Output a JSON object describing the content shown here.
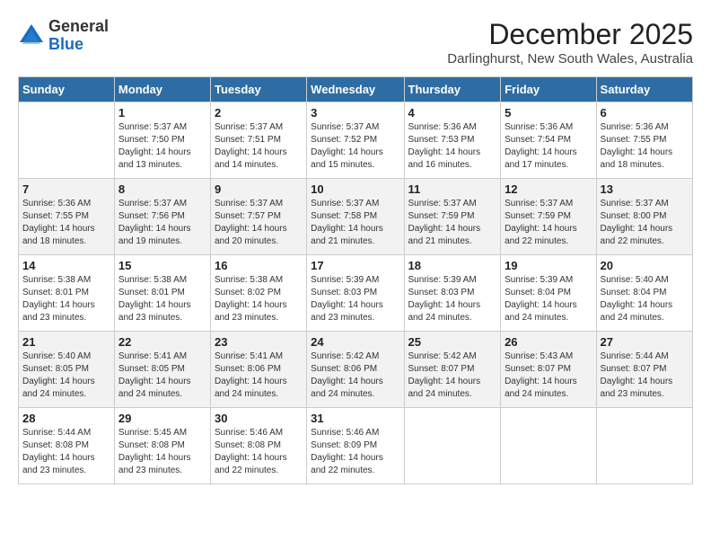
{
  "header": {
    "logo_general": "General",
    "logo_blue": "Blue",
    "month_title": "December 2025",
    "location": "Darlinghurst, New South Wales, Australia"
  },
  "weekdays": [
    "Sunday",
    "Monday",
    "Tuesday",
    "Wednesday",
    "Thursday",
    "Friday",
    "Saturday"
  ],
  "weeks": [
    [
      {
        "day": "",
        "detail": ""
      },
      {
        "day": "1",
        "detail": "Sunrise: 5:37 AM\nSunset: 7:50 PM\nDaylight: 14 hours\nand 13 minutes."
      },
      {
        "day": "2",
        "detail": "Sunrise: 5:37 AM\nSunset: 7:51 PM\nDaylight: 14 hours\nand 14 minutes."
      },
      {
        "day": "3",
        "detail": "Sunrise: 5:37 AM\nSunset: 7:52 PM\nDaylight: 14 hours\nand 15 minutes."
      },
      {
        "day": "4",
        "detail": "Sunrise: 5:36 AM\nSunset: 7:53 PM\nDaylight: 14 hours\nand 16 minutes."
      },
      {
        "day": "5",
        "detail": "Sunrise: 5:36 AM\nSunset: 7:54 PM\nDaylight: 14 hours\nand 17 minutes."
      },
      {
        "day": "6",
        "detail": "Sunrise: 5:36 AM\nSunset: 7:55 PM\nDaylight: 14 hours\nand 18 minutes."
      }
    ],
    [
      {
        "day": "7",
        "detail": "Sunrise: 5:36 AM\nSunset: 7:55 PM\nDaylight: 14 hours\nand 18 minutes."
      },
      {
        "day": "8",
        "detail": "Sunrise: 5:37 AM\nSunset: 7:56 PM\nDaylight: 14 hours\nand 19 minutes."
      },
      {
        "day": "9",
        "detail": "Sunrise: 5:37 AM\nSunset: 7:57 PM\nDaylight: 14 hours\nand 20 minutes."
      },
      {
        "day": "10",
        "detail": "Sunrise: 5:37 AM\nSunset: 7:58 PM\nDaylight: 14 hours\nand 21 minutes."
      },
      {
        "day": "11",
        "detail": "Sunrise: 5:37 AM\nSunset: 7:59 PM\nDaylight: 14 hours\nand 21 minutes."
      },
      {
        "day": "12",
        "detail": "Sunrise: 5:37 AM\nSunset: 7:59 PM\nDaylight: 14 hours\nand 22 minutes."
      },
      {
        "day": "13",
        "detail": "Sunrise: 5:37 AM\nSunset: 8:00 PM\nDaylight: 14 hours\nand 22 minutes."
      }
    ],
    [
      {
        "day": "14",
        "detail": "Sunrise: 5:38 AM\nSunset: 8:01 PM\nDaylight: 14 hours\nand 23 minutes."
      },
      {
        "day": "15",
        "detail": "Sunrise: 5:38 AM\nSunset: 8:01 PM\nDaylight: 14 hours\nand 23 minutes."
      },
      {
        "day": "16",
        "detail": "Sunrise: 5:38 AM\nSunset: 8:02 PM\nDaylight: 14 hours\nand 23 minutes."
      },
      {
        "day": "17",
        "detail": "Sunrise: 5:39 AM\nSunset: 8:03 PM\nDaylight: 14 hours\nand 23 minutes."
      },
      {
        "day": "18",
        "detail": "Sunrise: 5:39 AM\nSunset: 8:03 PM\nDaylight: 14 hours\nand 24 minutes."
      },
      {
        "day": "19",
        "detail": "Sunrise: 5:39 AM\nSunset: 8:04 PM\nDaylight: 14 hours\nand 24 minutes."
      },
      {
        "day": "20",
        "detail": "Sunrise: 5:40 AM\nSunset: 8:04 PM\nDaylight: 14 hours\nand 24 minutes."
      }
    ],
    [
      {
        "day": "21",
        "detail": "Sunrise: 5:40 AM\nSunset: 8:05 PM\nDaylight: 14 hours\nand 24 minutes."
      },
      {
        "day": "22",
        "detail": "Sunrise: 5:41 AM\nSunset: 8:05 PM\nDaylight: 14 hours\nand 24 minutes."
      },
      {
        "day": "23",
        "detail": "Sunrise: 5:41 AM\nSunset: 8:06 PM\nDaylight: 14 hours\nand 24 minutes."
      },
      {
        "day": "24",
        "detail": "Sunrise: 5:42 AM\nSunset: 8:06 PM\nDaylight: 14 hours\nand 24 minutes."
      },
      {
        "day": "25",
        "detail": "Sunrise: 5:42 AM\nSunset: 8:07 PM\nDaylight: 14 hours\nand 24 minutes."
      },
      {
        "day": "26",
        "detail": "Sunrise: 5:43 AM\nSunset: 8:07 PM\nDaylight: 14 hours\nand 24 minutes."
      },
      {
        "day": "27",
        "detail": "Sunrise: 5:44 AM\nSunset: 8:07 PM\nDaylight: 14 hours\nand 23 minutes."
      }
    ],
    [
      {
        "day": "28",
        "detail": "Sunrise: 5:44 AM\nSunset: 8:08 PM\nDaylight: 14 hours\nand 23 minutes."
      },
      {
        "day": "29",
        "detail": "Sunrise: 5:45 AM\nSunset: 8:08 PM\nDaylight: 14 hours\nand 23 minutes."
      },
      {
        "day": "30",
        "detail": "Sunrise: 5:46 AM\nSunset: 8:08 PM\nDaylight: 14 hours\nand 22 minutes."
      },
      {
        "day": "31",
        "detail": "Sunrise: 5:46 AM\nSunset: 8:09 PM\nDaylight: 14 hours\nand 22 minutes."
      },
      {
        "day": "",
        "detail": ""
      },
      {
        "day": "",
        "detail": ""
      },
      {
        "day": "",
        "detail": ""
      }
    ]
  ]
}
